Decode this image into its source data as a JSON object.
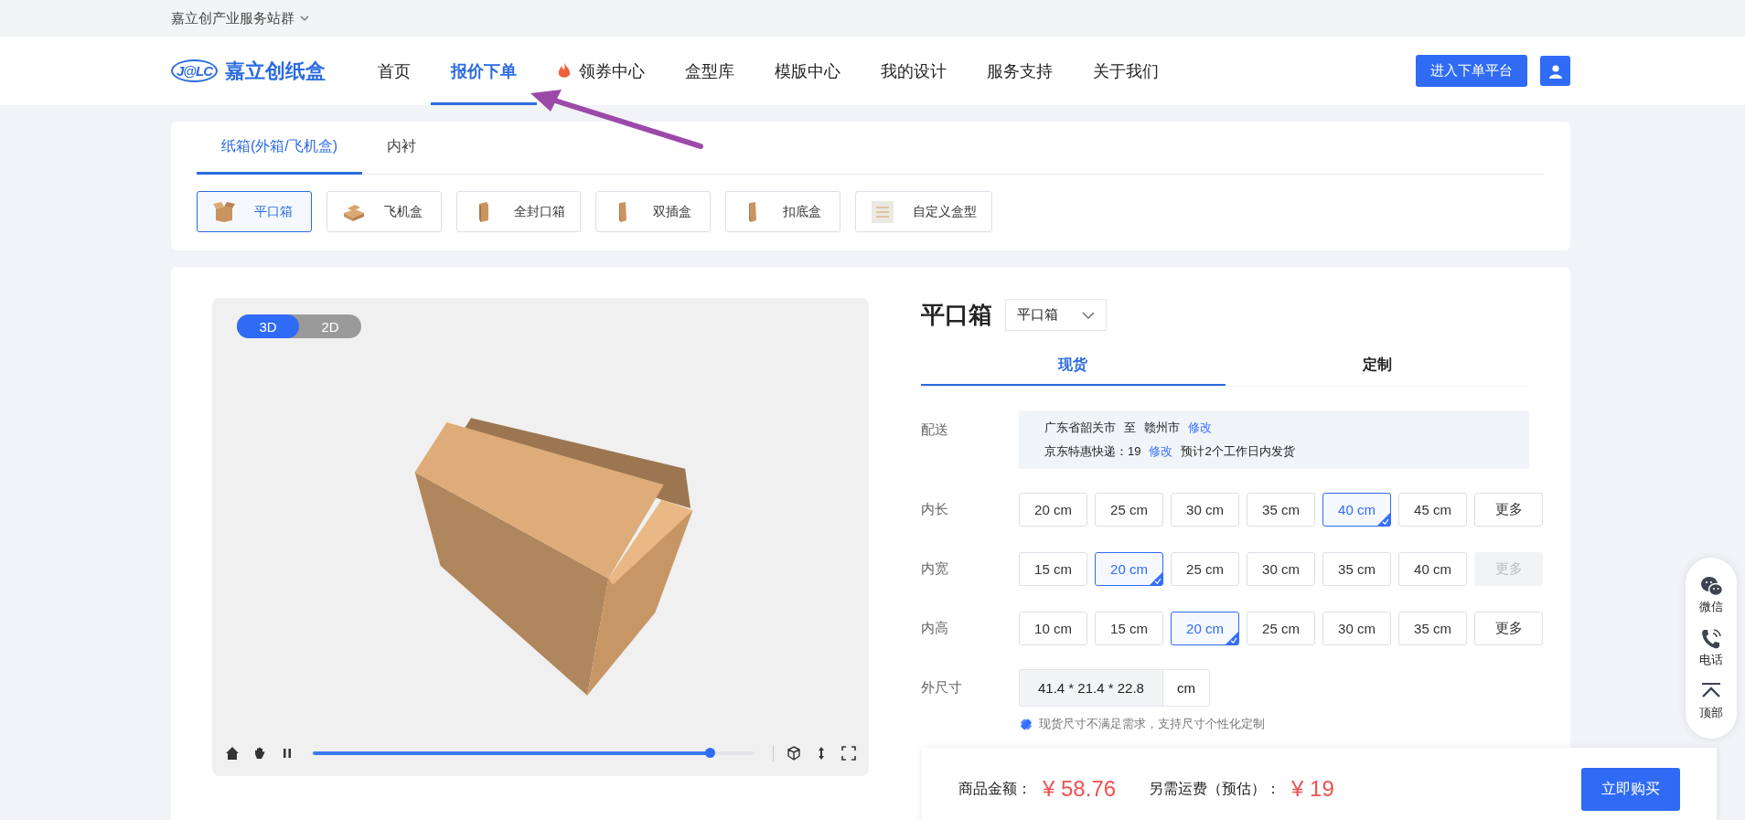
{
  "top_bar": {
    "label": "嘉立创产业服务站群"
  },
  "nav": {
    "logo_mark": "J@LC",
    "logo_text": "嘉立创纸盒",
    "items": [
      {
        "label": "首页",
        "selected": false,
        "kind": "plain"
      },
      {
        "label": "报价下单",
        "selected": true,
        "kind": "plain"
      },
      {
        "label": "领券中心",
        "selected": false,
        "kind": "fire"
      },
      {
        "label": "盒型库",
        "selected": false,
        "kind": "plain"
      },
      {
        "label": "模版中心",
        "selected": false,
        "kind": "plain"
      },
      {
        "label": "我的设计",
        "selected": false,
        "kind": "plain"
      },
      {
        "label": "服务支持",
        "selected": false,
        "kind": "plain"
      },
      {
        "label": "关于我们",
        "selected": false,
        "kind": "plain"
      }
    ],
    "cta": "进入下单平台"
  },
  "category_tabs": [
    {
      "label": "纸箱(外箱/飞机盒)",
      "selected": true
    },
    {
      "label": "内衬",
      "selected": false
    }
  ],
  "box_types": [
    {
      "label": "平口箱",
      "selected": true,
      "kind": "open"
    },
    {
      "label": "飞机盒",
      "selected": false,
      "kind": "flat"
    },
    {
      "label": "全封口箱",
      "selected": false,
      "kind": "tall"
    },
    {
      "label": "双插盒",
      "selected": false,
      "kind": "slim"
    },
    {
      "label": "扣底盒",
      "selected": false,
      "kind": "slim"
    },
    {
      "label": "自定义盒型",
      "selected": false,
      "kind": "custom"
    }
  ],
  "viewer": {
    "modes": [
      {
        "label": "3D",
        "selected": true
      },
      {
        "label": "2D",
        "selected": false
      }
    ],
    "progress": {
      "level": 0.9
    }
  },
  "product": {
    "title": "平口箱",
    "type_select": "平口箱",
    "tabs": [
      {
        "label": "现货",
        "selected": true
      },
      {
        "label": "定制",
        "selected": false
      }
    ],
    "delivery": {
      "label": "配送",
      "from": "广东省韶关市",
      "to_word": "至",
      "to": "赣州市",
      "edit": "修改",
      "shipping": "京东特惠快递：19",
      "edit2": "修改",
      "eta": "预计2个工作日内发货"
    },
    "sizes": [
      {
        "label": "内长",
        "options": [
          {
            "label": "20 cm",
            "selected": false,
            "disabled": false
          },
          {
            "label": "25 cm",
            "selected": false,
            "disabled": false
          },
          {
            "label": "30 cm",
            "selected": false,
            "disabled": false
          },
          {
            "label": "35 cm",
            "selected": false,
            "disabled": false
          },
          {
            "label": "40 cm",
            "selected": true,
            "disabled": false
          },
          {
            "label": "45 cm",
            "selected": false,
            "disabled": false
          },
          {
            "label": "更多",
            "selected": false,
            "disabled": false
          }
        ]
      },
      {
        "label": "内宽",
        "options": [
          {
            "label": "15 cm",
            "selected": false,
            "disabled": false
          },
          {
            "label": "20 cm",
            "selected": true,
            "disabled": false
          },
          {
            "label": "25 cm",
            "selected": false,
            "disabled": false
          },
          {
            "label": "30 cm",
            "selected": false,
            "disabled": false
          },
          {
            "label": "35 cm",
            "selected": false,
            "disabled": false
          },
          {
            "label": "40 cm",
            "selected": false,
            "disabled": false
          },
          {
            "label": "更多",
            "selected": false,
            "disabled": true
          }
        ]
      },
      {
        "label": "内高",
        "options": [
          {
            "label": "10 cm",
            "selected": false,
            "disabled": false
          },
          {
            "label": "15 cm",
            "selected": false,
            "disabled": false
          },
          {
            "label": "20 cm",
            "selected": true,
            "disabled": false
          },
          {
            "label": "25 cm",
            "selected": false,
            "disabled": false
          },
          {
            "label": "30 cm",
            "selected": false,
            "disabled": false
          },
          {
            "label": "35 cm",
            "selected": false,
            "disabled": false
          },
          {
            "label": "更多",
            "selected": false,
            "disabled": false
          }
        ]
      }
    ],
    "outer": {
      "label": "外尺寸",
      "value": "41.4 * 21.4 * 22.8",
      "unit": "cm"
    },
    "hint": "现货尺寸不满足需求，支持尺寸个性化定制"
  },
  "price_bar": {
    "label": "商品金额：",
    "price": "¥ 58.76",
    "shipping_label": "另需运费（预估）：",
    "shipping": "¥ 19",
    "buy": "立即购买"
  },
  "side_tools": [
    {
      "label": "微信",
      "kind": "wechat"
    },
    {
      "label": "电话",
      "kind": "phone"
    },
    {
      "label": "顶部",
      "kind": "top"
    }
  ]
}
